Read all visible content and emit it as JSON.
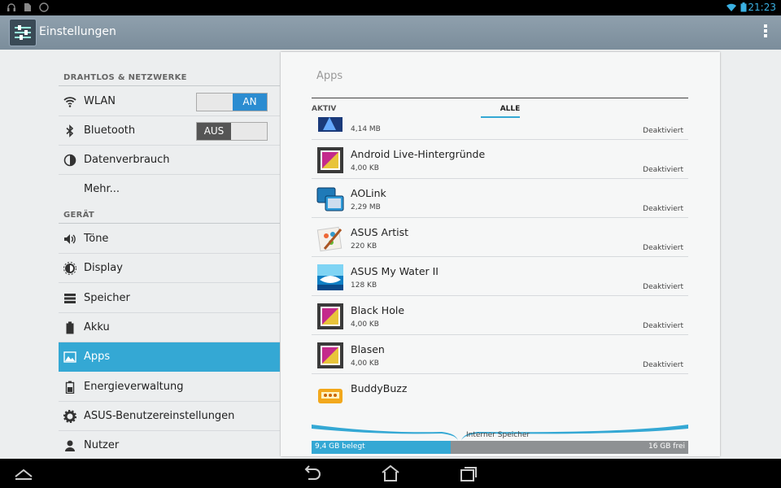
{
  "status_bar": {
    "time": "21:23"
  },
  "action_bar": {
    "title": "Einstellungen"
  },
  "sidebar": {
    "section_wireless": "DRAHTLOS & NETZWERKE",
    "section_device": "GERÄT",
    "wlan": {
      "label": "WLAN",
      "toggle": "AN"
    },
    "bluetooth": {
      "label": "Bluetooth",
      "toggle": "AUS"
    },
    "datenverbrauch": "Datenverbrauch",
    "mehr": "Mehr...",
    "toene": "Töne",
    "display": "Display",
    "speicher": "Speicher",
    "akku": "Akku",
    "apps": "Apps",
    "energie": "Energieverwaltung",
    "asus": "ASUS-Benutzereinstellungen",
    "nutzer": "Nutzer"
  },
  "panel": {
    "title": "Apps",
    "tabs": {
      "aktiv": "AKTIV",
      "alle": "ALLE"
    },
    "apps": [
      {
        "name": "",
        "size": "4,14 MB",
        "status": "Deaktiviert"
      },
      {
        "name": "Android Live-Hintergründe",
        "size": "4,00 KB",
        "status": "Deaktiviert"
      },
      {
        "name": "AOLink",
        "size": "2,29 MB",
        "status": "Deaktiviert"
      },
      {
        "name": "ASUS Artist",
        "size": "220 KB",
        "status": "Deaktiviert"
      },
      {
        "name": "ASUS My Water II",
        "size": "128 KB",
        "status": "Deaktiviert"
      },
      {
        "name": "Black Hole",
        "size": "4,00 KB",
        "status": "Deaktiviert"
      },
      {
        "name": "Blasen",
        "size": "4,00 KB",
        "status": "Deaktiviert"
      },
      {
        "name": "BuddyBuzz",
        "size": "",
        "status": ""
      }
    ],
    "storage": {
      "label": "Interner Speicher",
      "used": "9,4 GB belegt",
      "free": "16 GB frei",
      "used_fraction": 0.37
    }
  },
  "colors": {
    "accent": "#34a8d4",
    "action_bar": "#7b8d9b"
  }
}
